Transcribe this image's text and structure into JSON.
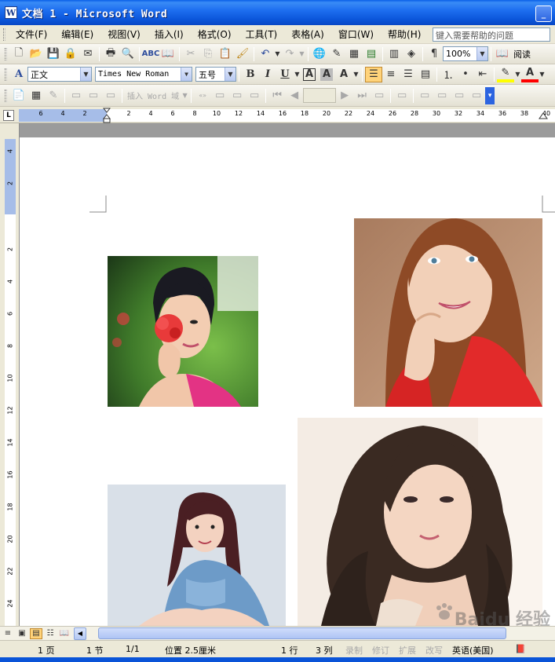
{
  "window": {
    "title": "文档 1 - Microsoft Word",
    "app_icon_letter": "W"
  },
  "menu": {
    "items": [
      "文件(F)",
      "编辑(E)",
      "视图(V)",
      "插入(I)",
      "格式(O)",
      "工具(T)",
      "表格(A)",
      "窗口(W)",
      "帮助(H)"
    ],
    "help_placeholder": "键入需要帮助的问题"
  },
  "standard_toolbar": {
    "zoom": "100%",
    "read_label": "阅读"
  },
  "formatting_toolbar": {
    "style": "正文",
    "font": "Times New Roman",
    "size": "五号",
    "bold": "B",
    "italic": "I",
    "underline": "U",
    "char_border": "A",
    "char_shade": "A",
    "scale": "A",
    "highlight_color": "#ffff00",
    "font_color": "#ff0000"
  },
  "mailmerge_toolbar": {
    "insert_word_field": "插入 Word 域"
  },
  "ruler": {
    "corner_label": "L",
    "h_ticks": [
      "6",
      "4",
      "2",
      "2",
      "4",
      "6",
      "8",
      "10",
      "12",
      "14",
      "16",
      "18",
      "20",
      "22",
      "24",
      "26",
      "28",
      "30",
      "32",
      "34",
      "36",
      "38",
      "40"
    ],
    "v_ticks_top": [
      "4",
      "2"
    ],
    "v_ticks": [
      "2",
      "4",
      "6",
      "8",
      "10",
      "12",
      "14",
      "16",
      "18",
      "20",
      "22",
      "24"
    ]
  },
  "status": {
    "page": "1 页",
    "section": "1 节",
    "page_of": "1/1",
    "position": "位置 2.5厘米",
    "line": "1 行",
    "column": "3 列",
    "rec": "录制",
    "trk": "修订",
    "ext": "扩展",
    "ovr": "改写",
    "language": "英语(美国)"
  },
  "watermark": {
    "text": "Baidu 经验"
  }
}
